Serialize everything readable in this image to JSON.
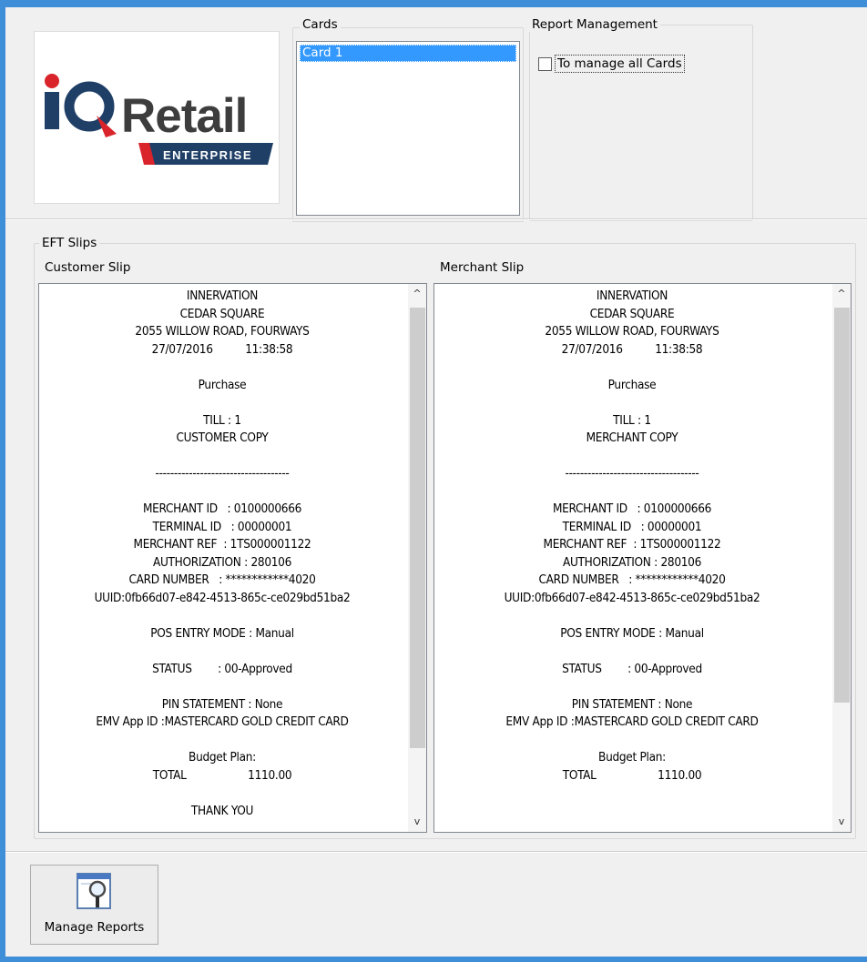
{
  "logo": {
    "brand_iq": "iQ",
    "brand_retail": "Retail",
    "edition": "ENTERPRISE"
  },
  "cards": {
    "label": "Cards",
    "items": [
      "Card 1"
    ]
  },
  "report_management": {
    "label": "Report Management",
    "checkbox_label": "To manage all Cards",
    "checked": false
  },
  "eft_slips": {
    "label": "EFT Slips",
    "customer_label": "Customer Slip",
    "merchant_label": "Merchant Slip",
    "customer_text": "INNERVATION\nCEDAR SQUARE\n2055 WILLOW ROAD, FOURWAYS\n27/07/2016          11:38:58\n\nPurchase\n\nTILL : 1\nCUSTOMER COPY\n\n------------------------------------\n\nMERCHANT ID   : 0100000666\nTERMINAL ID   : 00000001\nMERCHANT REF  : 1TS000001122\nAUTHORIZATION : 280106\nCARD NUMBER   : ************4020\nUUID:0fb66d07-e842-4513-865c-ce029bd51ba2\n\nPOS ENTRY MODE : Manual\n\nSTATUS        : 00-Approved\n\nPIN STATEMENT : None\nEMV App ID :MASTERCARD GOLD CREDIT CARD\n\nBudget Plan:\nTOTAL                   1110.00\n\nTHANK YOU",
    "merchant_text": "INNERVATION\nCEDAR SQUARE\n2055 WILLOW ROAD, FOURWAYS\n27/07/2016          11:38:58\n\nPurchase\n\nTILL : 1\nMERCHANT COPY\n\n------------------------------------\n\nMERCHANT ID   : 0100000666\nTERMINAL ID   : 00000001\nMERCHANT REF  : 1TS000001122\nAUTHORIZATION : 280106\nCARD NUMBER   : ************4020\nUUID:0fb66d07-e842-4513-865c-ce029bd51ba2\n\nPOS ENTRY MODE : Manual\n\nSTATUS        : 00-Approved\n\nPIN STATEMENT : None\nEMV App ID :MASTERCARD GOLD CREDIT CARD\n\nBudget Plan:\nTOTAL                   1110.00"
  },
  "manage_reports": {
    "label": "Manage Reports",
    "icon": "report-magnifier-icon"
  },
  "scroll": {
    "up_glyph": "^",
    "down_glyph": "v"
  }
}
